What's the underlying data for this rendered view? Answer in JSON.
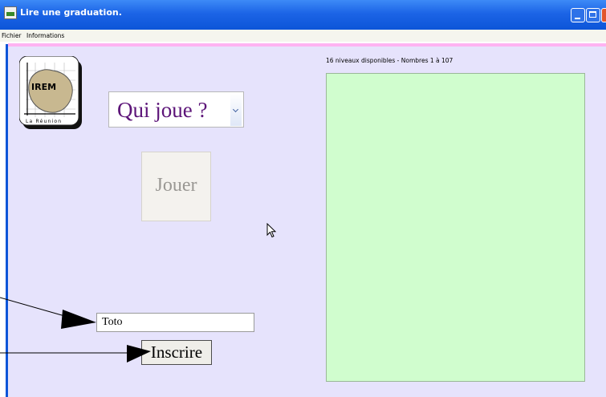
{
  "window": {
    "title": "Lire une graduation."
  },
  "titlebar_icons": [
    "app-icon",
    "minimize-icon",
    "maximize-icon",
    "close-icon"
  ],
  "menu": {
    "items": [
      {
        "label": "Fichier"
      },
      {
        "label": "Informations"
      }
    ]
  },
  "logo": {
    "text_main": "IREM",
    "text_sub": "La Réunion"
  },
  "player_select": {
    "value": "Qui joue ?"
  },
  "play_button": {
    "label": "Jouer"
  },
  "name_field": {
    "value": "Toto"
  },
  "register_button": {
    "label": "Inscrire"
  },
  "levels": {
    "info": "16 niveaux disponibles - Nombres 1 à 107"
  },
  "colors": {
    "titlebar": "#1c64e6",
    "client_background": "#e6e3fc",
    "levels_panel": "#d0fdce",
    "accent_line": "#ffb3f2",
    "select_text": "#5c1478"
  }
}
